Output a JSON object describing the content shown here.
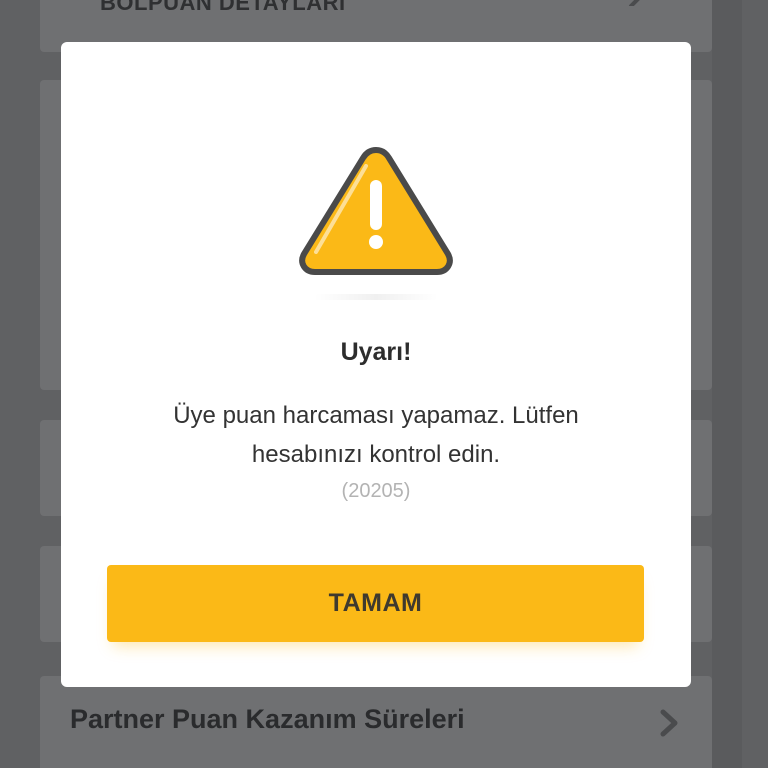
{
  "background": {
    "top_card_title": "BOLPUAN DETAYLARI",
    "bottom_card_title": "Partner Puan Kazanım Süreleri"
  },
  "dialog": {
    "icon": "warning-triangle-icon",
    "title": "Uyarı!",
    "message": "Üye puan harcaması yapamaz. Lütfen hesabınızı kontrol edin.",
    "code": "(20205)",
    "ok_label": "TAMAM"
  },
  "colors": {
    "accent": "#FBB917",
    "icon_outline": "#4A4A4A",
    "overlay": "#606163"
  }
}
